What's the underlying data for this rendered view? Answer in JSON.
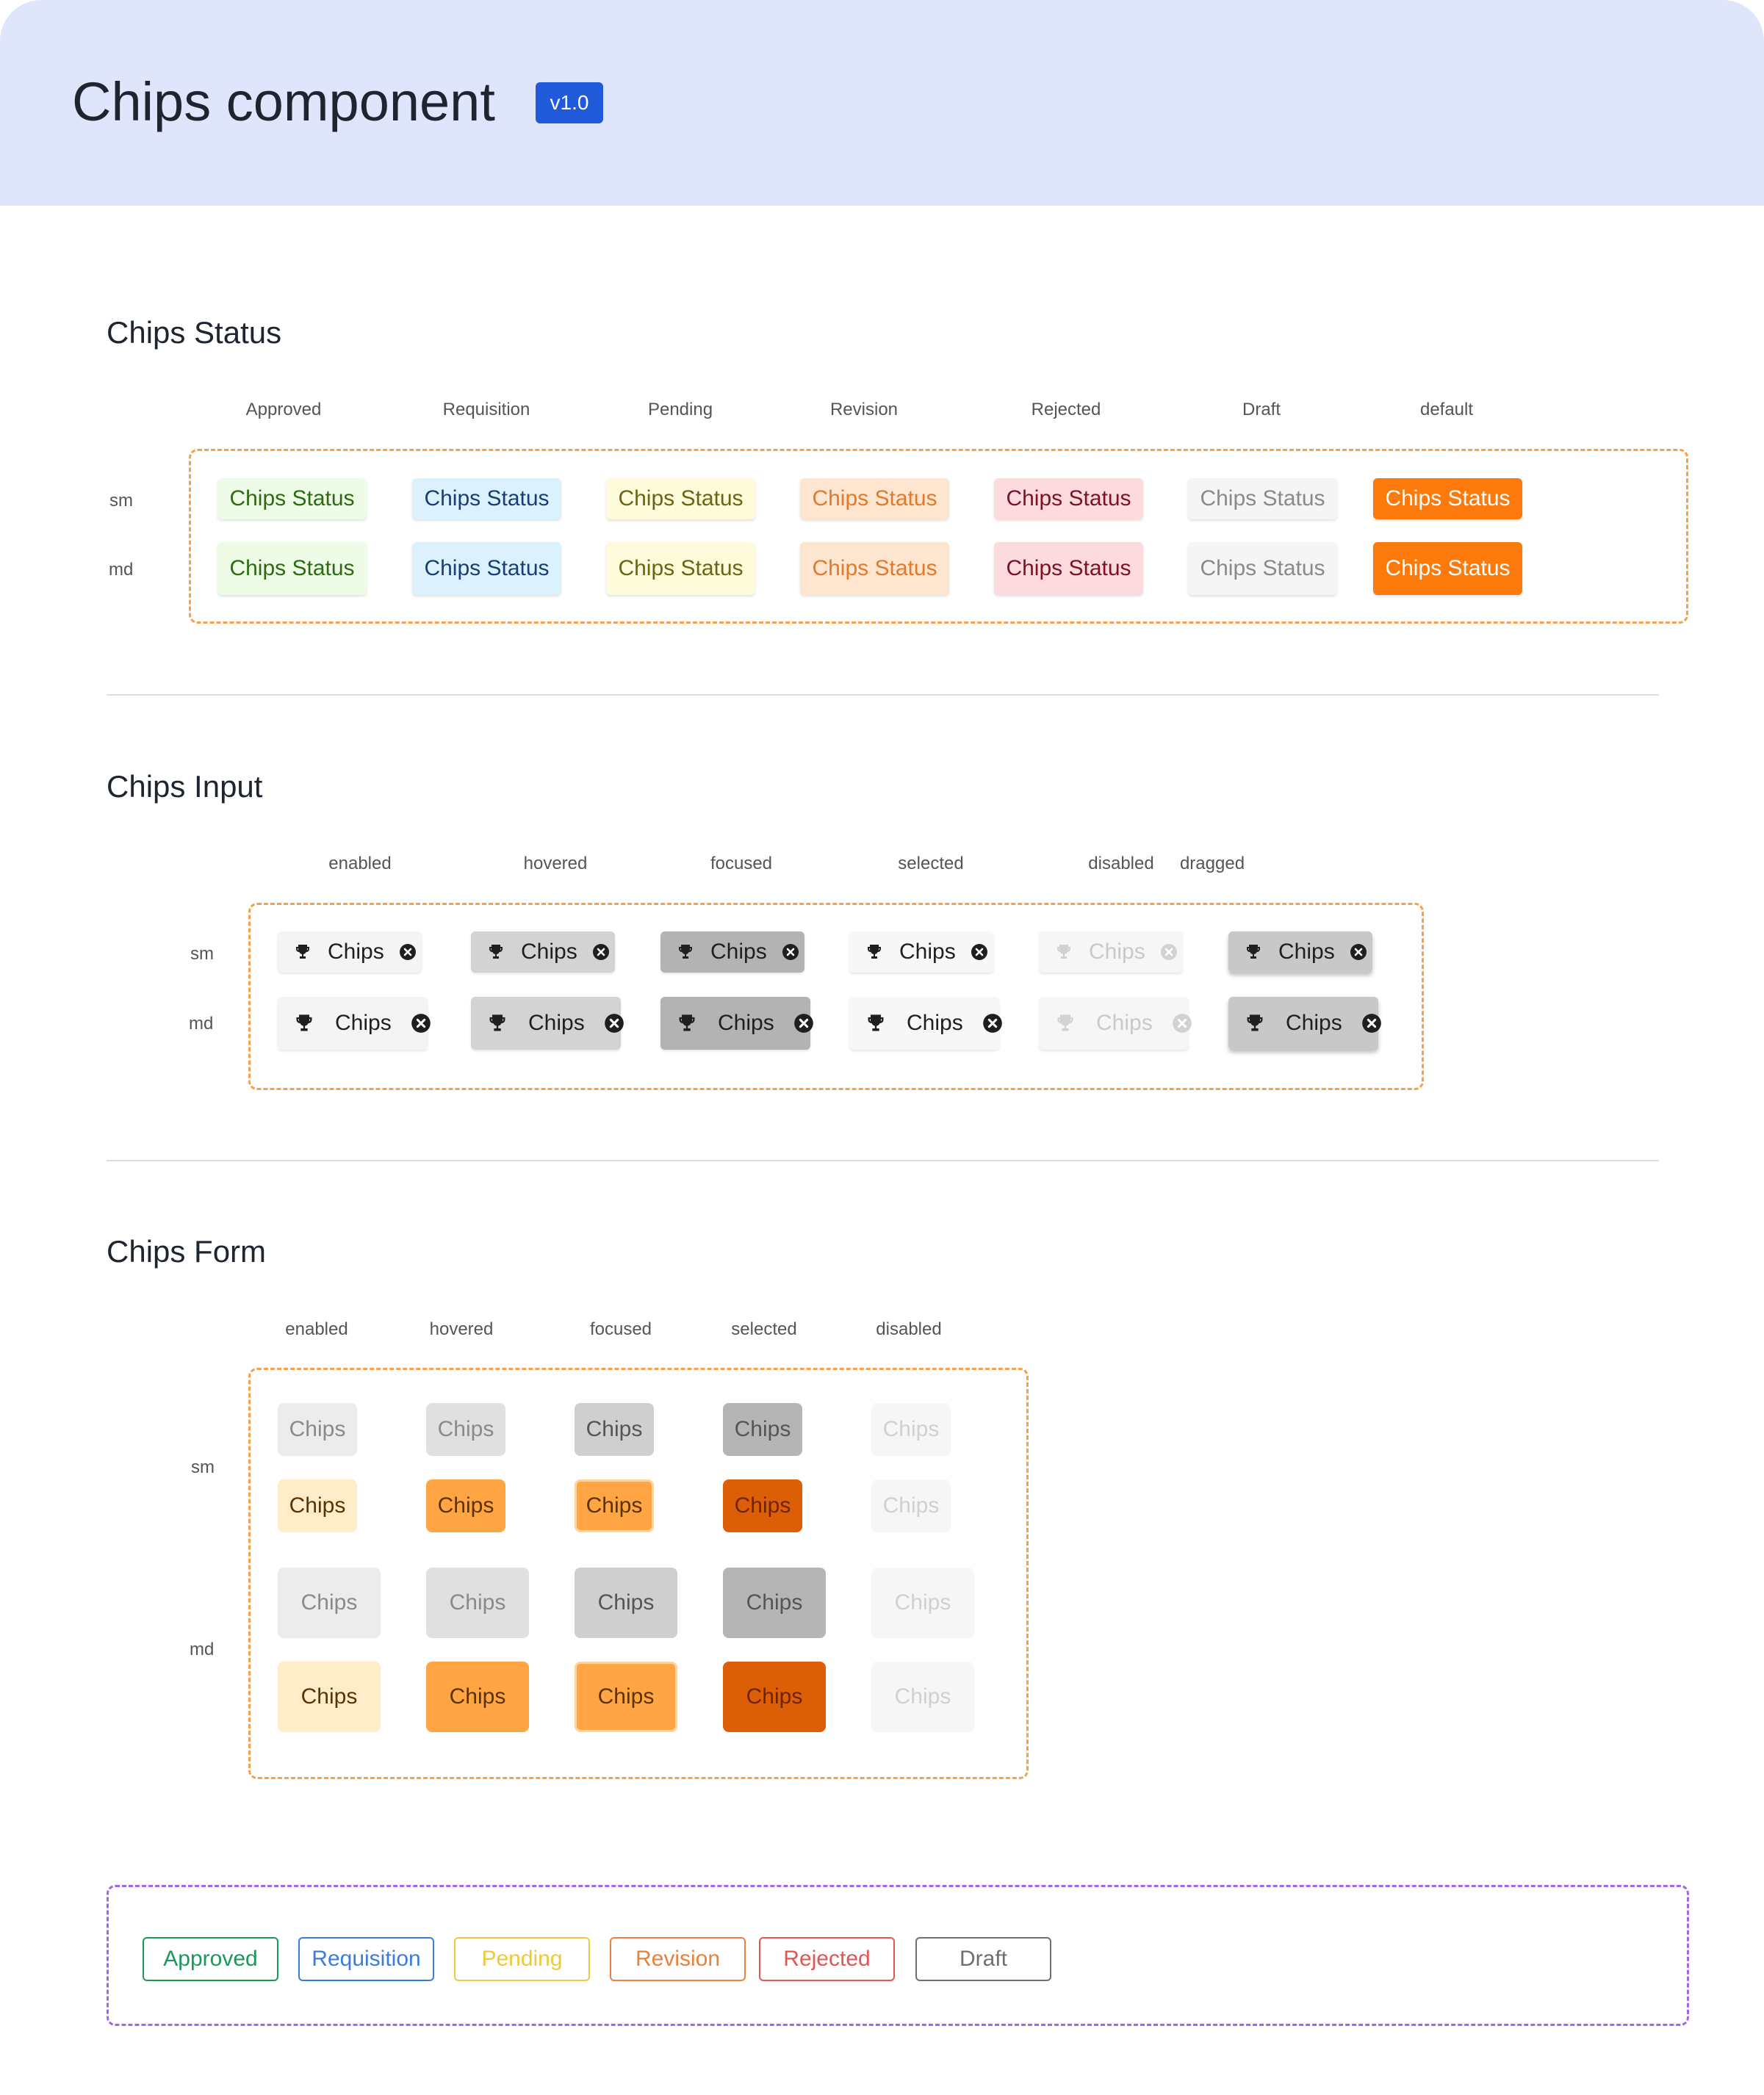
{
  "header": {
    "title": "Chips component",
    "version": "v1.0"
  },
  "status": {
    "title": "Chips Status",
    "columns": [
      "Approved",
      "Requisition",
      "Pending",
      "Revision",
      "Rejected",
      "Draft",
      "default"
    ],
    "rows": [
      "sm",
      "md"
    ],
    "chip_label": "Chips Status",
    "palette": [
      {
        "bg": "#eefbe6",
        "fg": "#2e6a12"
      },
      {
        "bg": "#dbf2fe",
        "fg": "#1a3e73"
      },
      {
        "bg": "#fdfbd9",
        "fg": "#6b6415"
      },
      {
        "bg": "#fde5cf",
        "fg": "#e07a2c"
      },
      {
        "bg": "#fcdadd",
        "fg": "#7a1326"
      },
      {
        "bg": "#f5f5f5",
        "fg": "#8a8a8a"
      },
      {
        "bg": "#fc7a0c",
        "fg": "#ffffff"
      }
    ]
  },
  "input": {
    "title": "Chips Input",
    "columns": [
      "enabled",
      "hovered",
      "focused",
      "selected",
      "disabled",
      "dragged"
    ],
    "rows": [
      "sm",
      "md"
    ],
    "chip_label": "Chips",
    "icons": {
      "leading": "trophy-icon",
      "trailing": "close-circle-icon"
    }
  },
  "form": {
    "title": "Chips Form",
    "columns": [
      "enabled",
      "hovered",
      "focused",
      "selected",
      "disabled"
    ],
    "rows": [
      "sm",
      "md"
    ],
    "chip_label": "Chips"
  },
  "legend": {
    "items": [
      {
        "label": "Approved",
        "color": "#1a9a5a"
      },
      {
        "label": "Requisition",
        "color": "#3b7ddc"
      },
      {
        "label": "Pending",
        "color": "#f0c93a"
      },
      {
        "label": "Revision",
        "color": "#e8823c"
      },
      {
        "label": "Rejected",
        "color": "#e45555"
      },
      {
        "label": "Draft",
        "color": "#6f6f6f"
      }
    ]
  }
}
